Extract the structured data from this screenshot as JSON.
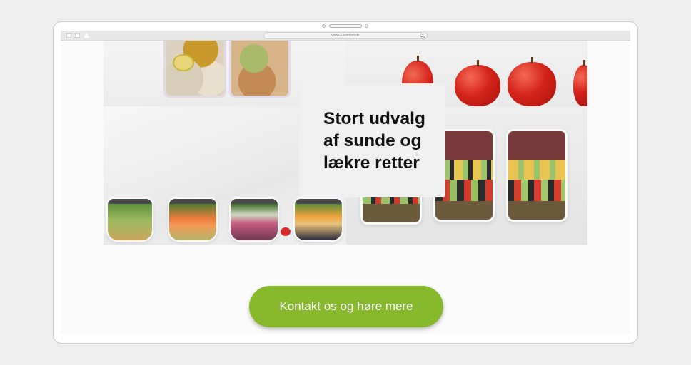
{
  "browser": {
    "url": "www.Eksimbot.dk"
  },
  "hero": {
    "headline_lines": [
      "Stort udvalg",
      "af sunde og",
      "lækre retter"
    ]
  },
  "cta": {
    "label": "Kontakt os og høre mere"
  },
  "colors": {
    "cta_background": "#86b92b",
    "headline_card": "#f0f0f0",
    "page_background": "#efefef"
  }
}
